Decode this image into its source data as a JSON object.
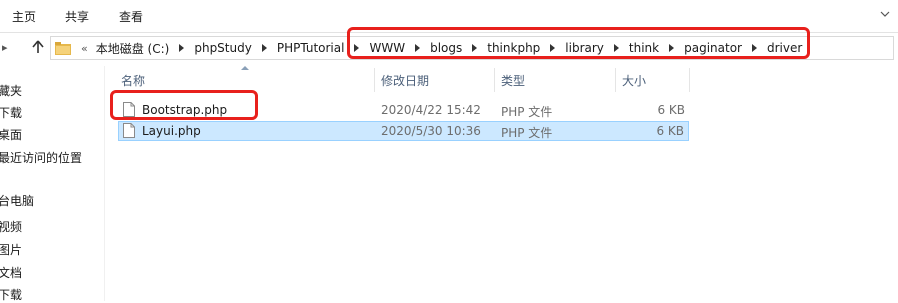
{
  "ribbon": {
    "tabs": [
      "主页",
      "共享",
      "查看"
    ]
  },
  "address": {
    "overflow": "«",
    "crumbs": [
      "本地磁盘 (C:)",
      "phpStudy",
      "PHPTutorial",
      "WWW",
      "blogs",
      "thinkphp",
      "library",
      "think",
      "paginator",
      "driver"
    ]
  },
  "navpane": {
    "items": [
      "藏夹",
      "下载",
      "桌面",
      "最近访问的位置",
      "台电脑",
      "视频",
      "图片",
      "文档",
      "下载"
    ]
  },
  "columns": {
    "name": "名称",
    "date": "修改日期",
    "type": "类型",
    "size": "大小"
  },
  "files": [
    {
      "name": "Bootstrap.php",
      "date": "2020/4/22 15:42",
      "type": "PHP 文件",
      "size": "6 KB"
    },
    {
      "name": "Layui.php",
      "date": "2020/5/30 10:36",
      "type": "PHP 文件",
      "size": "6 KB"
    }
  ],
  "colors": {
    "selection": "#cce8ff",
    "highlight": "#e8201c"
  }
}
